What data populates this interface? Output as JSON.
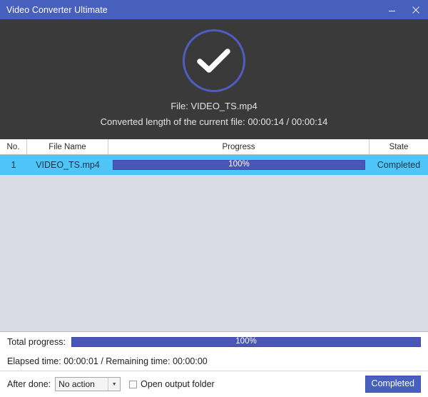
{
  "window": {
    "title": "Video Converter Ultimate",
    "titlebar_color": "#4860bd",
    "controls": {
      "minimize_name": "minimize-icon",
      "close_name": "close-icon"
    }
  },
  "status": {
    "icon": "check-circle-icon",
    "circle_color": "#4f5dc0",
    "panel_color": "#3a3a3a",
    "file_line": "File: VIDEO_TS.mp4",
    "length_line": "Converted length of the current file: 00:00:14 / 00:00:14"
  },
  "table": {
    "headers": {
      "no": "No.",
      "file_name": "File Name",
      "progress": "Progress",
      "state": "State"
    },
    "selected_row_color": "#4ec4f7",
    "bar_color": "#4a55b8",
    "empty_color": "#d9dce5",
    "rows": [
      {
        "no": "1",
        "file_name": "VIDEO_TS.mp4",
        "progress_text": "100%",
        "progress_percent": 100,
        "state": "Completed"
      }
    ]
  },
  "totals": {
    "label": "Total progress:",
    "progress_text": "100%",
    "progress_percent": 100,
    "elapsed": "Elapsed time: 00:00:01 / Remaining time: 00:00:00"
  },
  "footer": {
    "after_done_label": "After done:",
    "after_done_value": "No action",
    "after_done_arrow": "▼",
    "open_output_label": "Open output folder",
    "open_output_checked": false,
    "action_button": "Completed",
    "action_button_color": "#4860bd"
  }
}
